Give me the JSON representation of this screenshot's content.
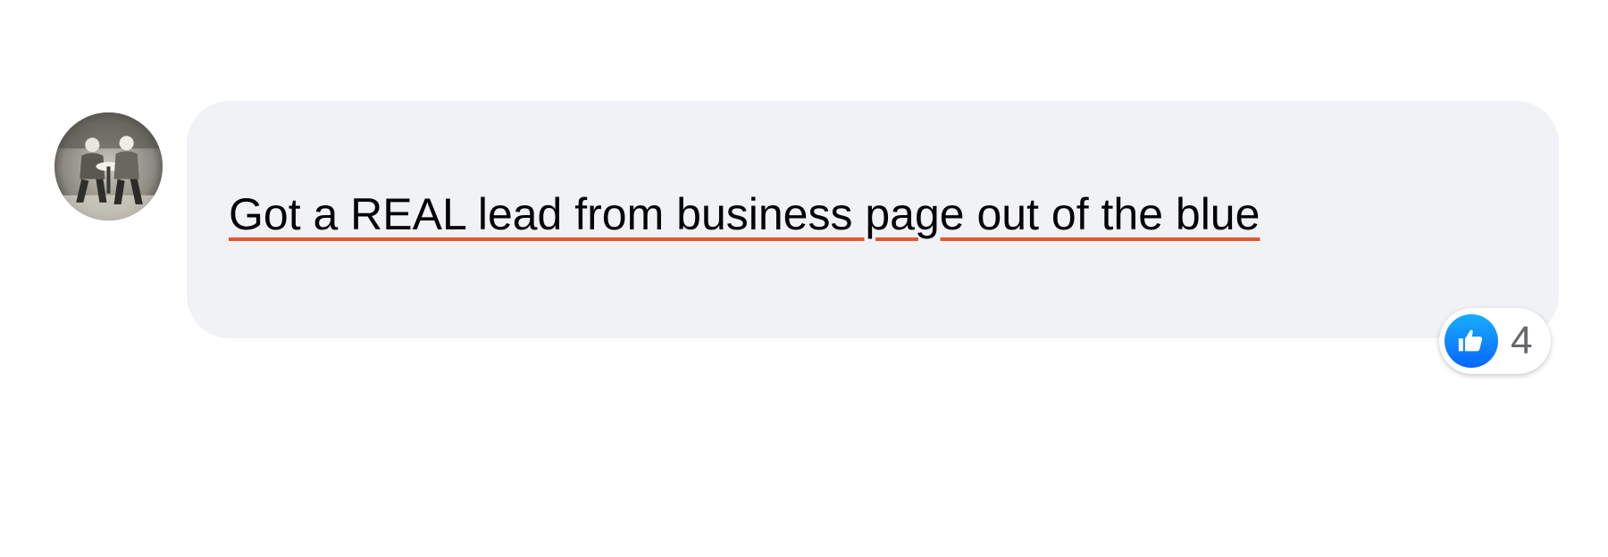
{
  "comment": {
    "text": "Got a REAL lead from business page out of the blue",
    "underline_color": "#e4572e"
  },
  "avatar": {
    "icon": "profile-photo"
  },
  "reactions": {
    "icon": "thumbs-up-icon",
    "count": "4",
    "color": "#0866ff"
  },
  "colors": {
    "bubble": "#f0f2f5",
    "text": "#050505",
    "count_text": "#65676b"
  }
}
